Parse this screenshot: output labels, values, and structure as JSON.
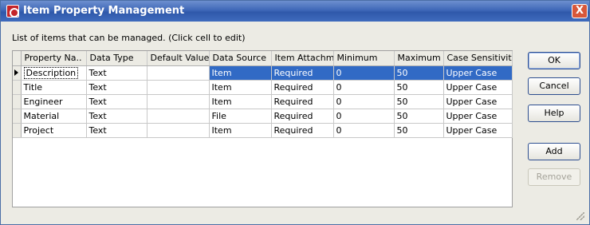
{
  "window": {
    "title": "Item Property Management",
    "close_label": "X"
  },
  "caption": "List of items that can be managed. (Click cell to edit)",
  "grid": {
    "columns": [
      "Property Na..",
      "Data Type",
      "Default Value",
      "Data Source",
      "Item Attachm..",
      "Minimum",
      "Maximum",
      "Case Sensitivity"
    ],
    "rows": [
      [
        "Description",
        "Text",
        "",
        "Item",
        "Required",
        "0",
        "50",
        "Upper Case"
      ],
      [
        "Title",
        "Text",
        "",
        "Item",
        "Required",
        "0",
        "50",
        "Upper Case"
      ],
      [
        "Engineer",
        "Text",
        "",
        "Item",
        "Required",
        "0",
        "50",
        "Upper Case"
      ],
      [
        "Material",
        "Text",
        "",
        "File",
        "Required",
        "0",
        "50",
        "Upper Case"
      ],
      [
        "Project",
        "Text",
        "",
        "Item",
        "Required",
        "0",
        "50",
        "Upper Case"
      ]
    ],
    "selected_row": 0
  },
  "buttons": {
    "ok": "OK",
    "cancel": "Cancel",
    "help": "Help",
    "add": "Add",
    "remove": "Remove"
  },
  "colors": {
    "titlebar": "#3f68b8",
    "selection": "#316ac5",
    "window_bg": "#ecebe4"
  }
}
